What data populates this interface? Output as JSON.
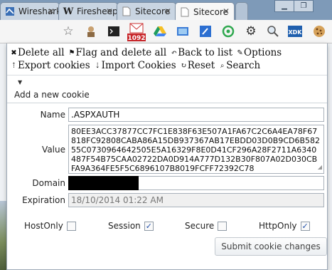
{
  "browser": {
    "tabs": [
      {
        "title": "Wireshark",
        "favicon": "wireshark-icon"
      },
      {
        "title": "Firesheep",
        "favicon": "wikipedia-icon"
      },
      {
        "title": "Sitecore",
        "favicon": "page-icon"
      },
      {
        "title": "Sitecore",
        "favicon": "page-icon",
        "active": true
      }
    ],
    "window_controls": [
      "minimize",
      "restore"
    ],
    "toolbar_icons": [
      "star-icon",
      "mustache-icon",
      "terminal-icon",
      "gmail-icon",
      "google-drive-icon",
      "screenshot-icon",
      "pencil-icon",
      "evernote-icon",
      "gear-icon",
      "magnifier-icon",
      "xdk-icon",
      "cookie-icon"
    ],
    "gmail_badge": "1092",
    "xdk_label": "XDK"
  },
  "menu": {
    "row1": [
      {
        "icon": "delete-all-icon",
        "label": "Delete all"
      },
      {
        "icon": "flag-icon",
        "label": "Flag and delete all"
      },
      {
        "icon": "back-icon",
        "label": "Back to list"
      },
      {
        "icon": "wrench-icon",
        "label": "Options"
      }
    ],
    "row2": [
      {
        "icon": "export-icon",
        "label": "Export cookies"
      },
      {
        "icon": "import-icon",
        "label": "Import Cookies"
      },
      {
        "icon": "reset-icon",
        "label": "Reset"
      },
      {
        "icon": "search-icon",
        "label": "Search"
      }
    ]
  },
  "add_cookie": {
    "label": "Add a new cookie"
  },
  "cookie": {
    "name_label": "Name",
    "name": ".ASPXAUTH",
    "value_label": "Value",
    "value": "80EE3ACC37877CC7FC1E838F63E507A1FA67C2C6A4EA78F67818FC92808CABA86A15DB937367AB17EBDD03D0B9CD6B58255C0730964642505E5A16329F8E0D41CF296A28F2711A6340487F54B75CAA02722DA0D914A777D132B30F807A02D030CBFA9A364FE5F5C6896107B8019FCFF72392C78",
    "domain_label": "Domain",
    "expiration_label": "Expiration",
    "expiration": "18/10/2014 01:22 AM"
  },
  "flags": {
    "hostonly": {
      "label": "HostOnly",
      "checked": false
    },
    "session": {
      "label": "Session",
      "checked": true
    },
    "secure": {
      "label": "Secure",
      "checked": false
    },
    "httponly": {
      "label": "HttpOnly",
      "checked": true
    }
  },
  "submit_label": "Submit cookie changes"
}
